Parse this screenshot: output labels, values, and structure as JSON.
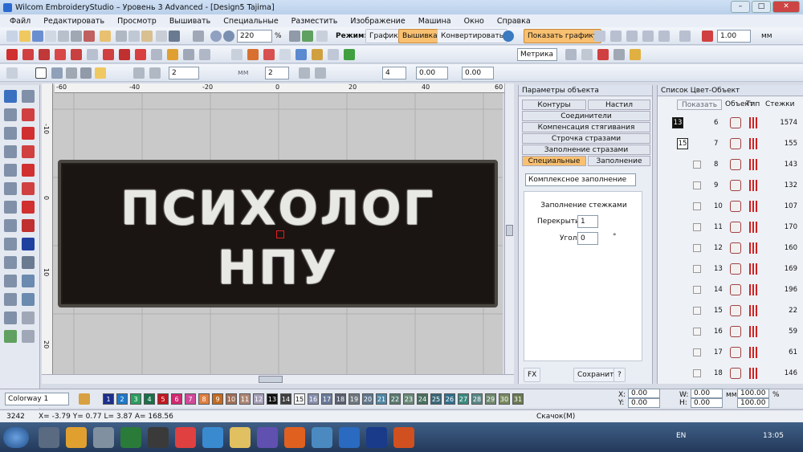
{
  "window": {
    "title": "Wilcom EmbroideryStudio – Уровень 3 Advanced - [Design5        Tajima]"
  },
  "menu": [
    "Файл",
    "Редактировать",
    "Просмотр",
    "Вышивать",
    "Специальные",
    "Разместить",
    "Изображение",
    "Машина",
    "Окно",
    "Справка"
  ],
  "toolbar": {
    "zoom": "220",
    "zoom_unit": "%",
    "mode_label": "Режим:",
    "mode_graphics": "Графика",
    "mode_embroidery": "Вышивка",
    "mode_convert": "Конвертировать",
    "show_graphics": "Показать графику",
    "pen_width": "1.00",
    "pen_unit": "мм",
    "units": "Метрика",
    "val1": "2",
    "val2": "2",
    "val3": "4",
    "val4": "0.00",
    "val5": "0.00",
    "val6": "0.00",
    "unit_mm": "мм"
  },
  "ruler": {
    "h": [
      "-60",
      "-40",
      "-20",
      "0",
      "20",
      "40",
      "60"
    ],
    "v": [
      "-10",
      "0",
      "10",
      "20"
    ]
  },
  "design": {
    "line1": "ПСИХОЛОГ",
    "line2": "НПУ"
  },
  "object_panel": {
    "title": "Параметры объекта",
    "tabs": [
      "Контуры",
      "Настил",
      "Соединители",
      "Компенсация стягивания",
      "Строчка стразами",
      "Заполнение стразами",
      "Специальные",
      "Заполнение"
    ],
    "fill_type": "Комплексное заполнение",
    "section": "Заполнение стежками",
    "overlap_label": "Перекрытие",
    "overlap": "1",
    "angle_label": "Угол",
    "angle": "0",
    "angle_unit": "°",
    "fx": "FX",
    "save": "Сохранить",
    "help": "?"
  },
  "color_list": {
    "title": "Список Цвет-Объект",
    "show": "Показать",
    "col_obj": "Объект",
    "col_type": "Тип",
    "col_stitches": "Стежки",
    "rows": [
      {
        "color": "13",
        "num": "6",
        "stitches": "1574"
      },
      {
        "color": "15",
        "num": "7",
        "stitches": "155"
      },
      {
        "color": "",
        "num": "8",
        "stitches": "143"
      },
      {
        "color": "",
        "num": "9",
        "stitches": "132"
      },
      {
        "color": "",
        "num": "10",
        "stitches": "107"
      },
      {
        "color": "",
        "num": "11",
        "stitches": "170"
      },
      {
        "color": "",
        "num": "12",
        "stitches": "160"
      },
      {
        "color": "",
        "num": "13",
        "stitches": "169"
      },
      {
        "color": "",
        "num": "14",
        "stitches": "196"
      },
      {
        "color": "",
        "num": "15",
        "stitches": "22"
      },
      {
        "color": "",
        "num": "16",
        "stitches": "59"
      },
      {
        "color": "",
        "num": "17",
        "stitches": "61"
      },
      {
        "color": "",
        "num": "18",
        "stitches": "146"
      }
    ]
  },
  "palette": {
    "colorway": "Colorway 1",
    "swatches": [
      {
        "n": "1",
        "c": "#1b2f8c"
      },
      {
        "n": "2",
        "c": "#1f78c8"
      },
      {
        "n": "3",
        "c": "#2aa060"
      },
      {
        "n": "4",
        "c": "#18704a"
      },
      {
        "n": "5",
        "c": "#c01820"
      },
      {
        "n": "6",
        "c": "#d02a70"
      },
      {
        "n": "7",
        "c": "#d04a9a"
      },
      {
        "n": "8",
        "c": "#e08040"
      },
      {
        "n": "9",
        "c": "#c46a20"
      },
      {
        "n": "10",
        "c": "#a07058"
      },
      {
        "n": "11",
        "c": "#b08878"
      },
      {
        "n": "12",
        "c": "#a8a0b8"
      },
      {
        "n": "13",
        "c": "#111111"
      },
      {
        "n": "14",
        "c": "#404040"
      },
      {
        "n": "15",
        "c": "#f4f4f4"
      },
      {
        "n": "16",
        "c": "#8890b0"
      },
      {
        "n": "17",
        "c": "#6a7a9a"
      },
      {
        "n": "18",
        "c": "#5a6070"
      },
      {
        "n": "19",
        "c": "#707880"
      },
      {
        "n": "20",
        "c": "#607890"
      },
      {
        "n": "21",
        "c": "#4f88a8"
      },
      {
        "n": "22",
        "c": "#5a7a70"
      },
      {
        "n": "23",
        "c": "#6a8a78"
      },
      {
        "n": "24",
        "c": "#4a7060"
      },
      {
        "n": "25",
        "c": "#3a6878"
      },
      {
        "n": "26",
        "c": "#2f7090"
      },
      {
        "n": "27",
        "c": "#3a8a80"
      },
      {
        "n": "28",
        "c": "#5a8888"
      },
      {
        "n": "29",
        "c": "#708a70"
      },
      {
        "n": "30",
        "c": "#7a8a60"
      },
      {
        "n": "31",
        "c": "#6a7a50"
      }
    ]
  },
  "coords": {
    "x_label": "X:",
    "x": "0.00",
    "y_label": "Y:",
    "y": "0.00",
    "w_label": "W:",
    "w": "0.00",
    "h_label": "H:",
    "h": "0.00",
    "unit": "мм",
    "pct1": "100.00",
    "pct2": "100.00",
    "pct_unit": "%"
  },
  "status": {
    "count": "3242",
    "coords": "X=  -3.79 Y=   0.77 L=   3.87 A= 168.56",
    "stitch_mode": "Скачок(M)"
  },
  "taskbar": {
    "lang": "EN",
    "time": "13:05"
  }
}
